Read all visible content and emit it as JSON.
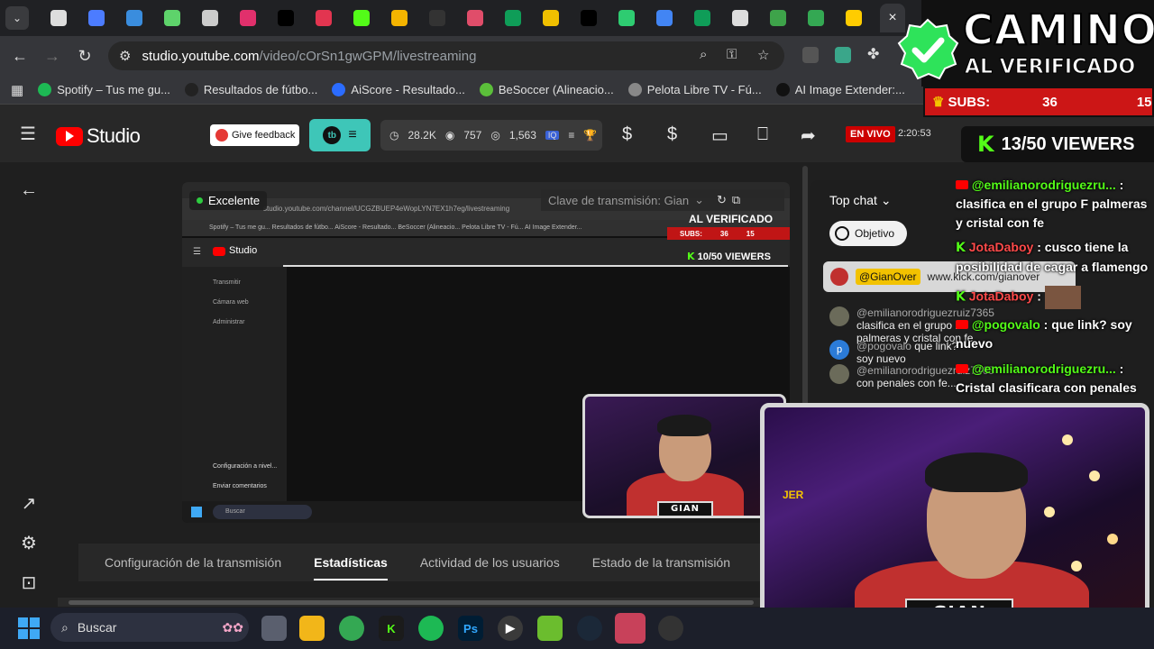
{
  "browser": {
    "active_tab_close": "×",
    "tab_colors": [
      "#dddddd",
      "#4c7cff",
      "#3a8dde",
      "#5ed36b",
      "#cccccc",
      "#e1306c",
      "#000000",
      "#e23550",
      "#53fc18",
      "#f4b400",
      "#333333",
      "#e04d6a",
      "#0f9d58",
      "#f0c000",
      "#000000",
      "#2ecc71",
      "#4285f4",
      "#0f9d58",
      "#dddddd",
      "#3ea34a",
      "#34a853",
      "#ffcc00"
    ],
    "url_host": "studio.youtube.com",
    "url_path": "/video/cOrSn1gwGPM/livestreaming",
    "bookmarks": [
      {
        "label": "Spotify – Tus me gu...",
        "color": "#1db954"
      },
      {
        "label": "Resultados de fútbo...",
        "color": "#222222"
      },
      {
        "label": "AiScore - Resultado...",
        "color": "#2b6cff"
      },
      {
        "label": "BeSoccer (Alineacio...",
        "color": "#5bbf3a"
      },
      {
        "label": "Pelota Libre TV - Fú...",
        "color": "#888888"
      },
      {
        "label": "AI Image Extender:...",
        "color": "#111111"
      }
    ]
  },
  "studio": {
    "logo_text": "Studio",
    "feedback_label": "Give feedback",
    "stats": {
      "views": "28.2K",
      "likes": "757",
      "watching": "1,563"
    },
    "live_badge": "EN VIVO",
    "live_time": "2:20:53"
  },
  "preview": {
    "quality": "Excelente",
    "stream_key_placeholder": "Clave de transmisión: Gian",
    "mini_url": "studio.youtube.com/channel/UCGZBUEP4eWopLYN7EX1h7eg/livestreaming",
    "mini_bookmarks": "Spotify – Tus me gu...    Resultados de fútbo...    AiScore - Resultado...    BeSoccer (Alineacio...    Pelota Libre TV - Fú...    AI Image Extender...",
    "mini_side": [
      "Transmitir",
      "Cámara web",
      "Administrar"
    ],
    "mini_side_bottom": [
      "Configuración a nivel...",
      "Enviar comentarios"
    ],
    "mini_search": "Buscar",
    "mini_viewers": "10/50 VIEWERS",
    "mini_subs_label": "SUBS:",
    "mini_subs_value": "36",
    "mini_subs_goal": "15",
    "mini_verified": "AL VERIFICADO",
    "cam_nameplate": "GIAN OVER"
  },
  "tabs": [
    {
      "label": "Configuración de la transmisión"
    },
    {
      "label": "Estadísticas"
    },
    {
      "label": "Actividad de los usuarios"
    },
    {
      "label": "Estado de la transmisión"
    }
  ],
  "chat": {
    "mode": "Top chat",
    "goal_label": "Objetivo",
    "pinned_user": "@GianOver",
    "pinned_text": "www.kick.com/gianover",
    "messages": [
      {
        "user": "@emilianorodriguezruiz7365",
        "text": "clasifica en el grupo F palmeras y cristal con fe",
        "color": "#6b6b5a"
      },
      {
        "user": "@pogovalo",
        "text": "que link? soy nuevo",
        "color": "#2b7bd8"
      },
      {
        "user": "@emilianorodriguezruiz7365",
        "text": "con penales con fe...",
        "color": "#6b6b5a"
      }
    ]
  },
  "overlay": {
    "title_line1": "CAMINO",
    "title_line2": "AL VERIFICADO",
    "subs_label": "SUBS:",
    "subs_value": "36",
    "subs_goal": "15",
    "viewers": "13/50 VIEWERS",
    "chat": [
      {
        "name": "@emilianorodriguezru...",
        "text": "clasifica en el grupo F palmeras y cristal con fe"
      },
      {
        "name": "JotaDaboy",
        "text": "cusco tiene la posibilidad de cagar a flamengo"
      },
      {
        "name": "JotaDaboy",
        "text": ""
      },
      {
        "name": "@pogovalo",
        "text": "que link? soy nuevo"
      },
      {
        "name": "@emilianorodriguezru...",
        "text": "Cristal clasificara con penales con"
      }
    ],
    "nameplate": "GIAN OVER",
    "cam_side_text": "JER"
  },
  "taskbar": {
    "search": "Buscar"
  }
}
